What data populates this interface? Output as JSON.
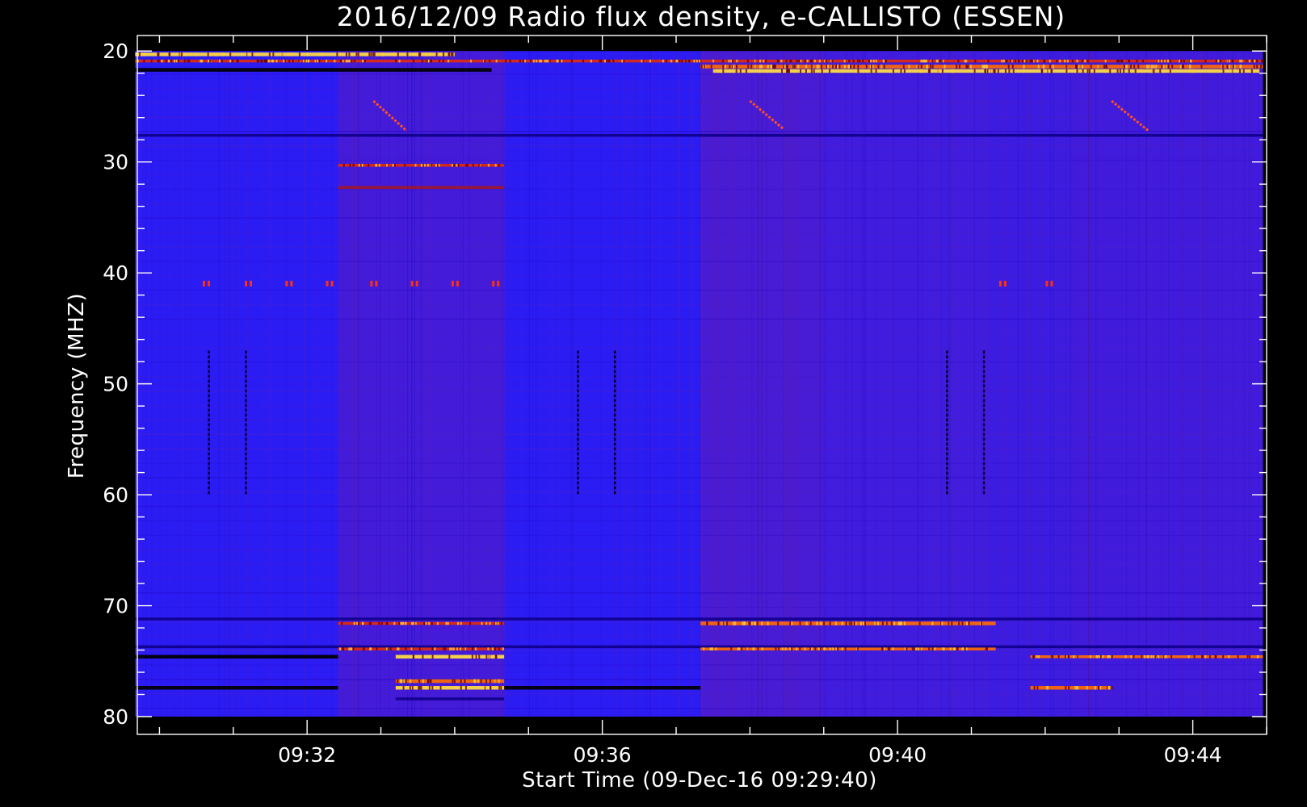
{
  "chart_data": {
    "type": "heatmap",
    "title": "2016/12/09  Radio flux density, e-CALLISTO (ESSEN)",
    "xlabel": "Start Time (09-Dec-16 09:29:40)",
    "ylabel": "Frequency (MHZ)",
    "x_tick_labels": [
      "09:32",
      "09:36",
      "09:40",
      "09:44"
    ],
    "x_tick_minutes": [
      32,
      36,
      40,
      44
    ],
    "y_tick_labels": [
      "20",
      "30",
      "40",
      "50",
      "60",
      "70",
      "80"
    ],
    "y_tick_values": [
      20,
      30,
      40,
      50,
      60,
      70,
      80
    ],
    "xlim_minutes": [
      29.7,
      45.0
    ],
    "ylim": [
      18.6,
      81.6
    ],
    "data_extent": {
      "start_minutes": 29.67,
      "end_minutes": 44.95,
      "freq_min": 20,
      "freq_max": 80
    },
    "y_axis_inverted": true,
    "colormap": [
      "#000000",
      "#1a00b8",
      "#3a1cff",
      "#6a20c8",
      "#b01818",
      "#ff3c00",
      "#ffd200",
      "#ffff80"
    ],
    "background_color": "#2c1cf4",
    "segments_minutes": [
      {
        "start": 29.67,
        "end": 32.42,
        "level": 0.0
      },
      {
        "start": 32.42,
        "end": 34.67,
        "level": 0.35
      },
      {
        "start": 34.67,
        "end": 37.33,
        "level": 0.0
      },
      {
        "start": 37.33,
        "end": 39.0,
        "level": 0.55
      },
      {
        "start": 39.0,
        "end": 41.25,
        "level": 0.2
      },
      {
        "start": 41.25,
        "end": 42.33,
        "level": 0.1
      },
      {
        "start": 42.33,
        "end": 44.95,
        "level": 0.25
      }
    ],
    "bands": [
      {
        "freq": 20.3,
        "start": 29.67,
        "end": 34.0,
        "intensity": 1.0
      },
      {
        "freq": 20.9,
        "start": 29.67,
        "end": 44.95,
        "intensity": 0.72
      },
      {
        "freq": 21.4,
        "start": 37.33,
        "end": 44.95,
        "intensity": 0.9
      },
      {
        "freq": 21.7,
        "start": 29.67,
        "end": 34.5,
        "intensity": -1.0
      },
      {
        "freq": 21.8,
        "start": 37.5,
        "end": 44.9,
        "intensity": 0.95
      },
      {
        "freq": 27.6,
        "start": 29.67,
        "end": 44.95,
        "intensity": -0.6
      },
      {
        "freq": 30.3,
        "start": 32.42,
        "end": 34.67,
        "intensity": 0.55
      },
      {
        "freq": 32.3,
        "start": 32.42,
        "end": 34.67,
        "intensity": 0.45
      },
      {
        "freq": 71.2,
        "start": 29.67,
        "end": 44.95,
        "intensity": -0.5
      },
      {
        "freq": 71.6,
        "start": 32.42,
        "end": 34.67,
        "intensity": 0.75
      },
      {
        "freq": 71.6,
        "start": 37.33,
        "end": 41.33,
        "intensity": 0.85
      },
      {
        "freq": 73.7,
        "start": 29.67,
        "end": 44.95,
        "intensity": -0.4
      },
      {
        "freq": 73.9,
        "start": 32.42,
        "end": 34.67,
        "intensity": 0.65
      },
      {
        "freq": 73.9,
        "start": 37.33,
        "end": 41.33,
        "intensity": 0.8
      },
      {
        "freq": 74.6,
        "start": 29.67,
        "end": 32.42,
        "intensity": -0.9
      },
      {
        "freq": 74.6,
        "start": 33.2,
        "end": 34.67,
        "intensity": 0.95
      },
      {
        "freq": 74.6,
        "start": 41.8,
        "end": 44.95,
        "intensity": 0.8
      },
      {
        "freq": 76.8,
        "start": 33.2,
        "end": 34.67,
        "intensity": 0.85
      },
      {
        "freq": 77.4,
        "start": 29.67,
        "end": 32.42,
        "intensity": -1.0
      },
      {
        "freq": 77.4,
        "start": 33.2,
        "end": 34.67,
        "intensity": 1.0
      },
      {
        "freq": 77.4,
        "start": 34.67,
        "end": 37.33,
        "intensity": -0.9
      },
      {
        "freq": 77.4,
        "start": 41.8,
        "end": 42.9,
        "intensity": 0.9
      },
      {
        "freq": 78.4,
        "start": 33.2,
        "end": 34.67,
        "intensity": -0.7
      }
    ],
    "drifting_features": [
      {
        "start_time": 32.9,
        "start_freq": 24.5,
        "end_time": 33.35,
        "end_freq": 27.2
      },
      {
        "start_time": 38.0,
        "start_freq": 24.5,
        "end_time": 38.45,
        "end_freq": 27.0
      },
      {
        "start_time": 42.9,
        "start_freq": 24.5,
        "end_time": 43.4,
        "end_freq": 27.2
      }
    ],
    "spots_freq": 41.0,
    "spots_minutes": [
      30.63,
      31.2,
      31.75,
      32.3,
      32.9,
      33.45,
      34.0,
      34.55,
      41.42,
      42.05
    ],
    "vertical_lines": [
      {
        "time": 30.67,
        "freq_start": 47,
        "freq_end": 60
      },
      {
        "time": 31.17,
        "freq_start": 47,
        "freq_end": 60
      },
      {
        "time": 35.67,
        "freq_start": 47,
        "freq_end": 60
      },
      {
        "time": 36.17,
        "freq_start": 47,
        "freq_end": 60
      },
      {
        "time": 40.67,
        "freq_start": 47,
        "freq_end": 60
      },
      {
        "time": 41.17,
        "freq_start": 47,
        "freq_end": 60
      }
    ]
  }
}
